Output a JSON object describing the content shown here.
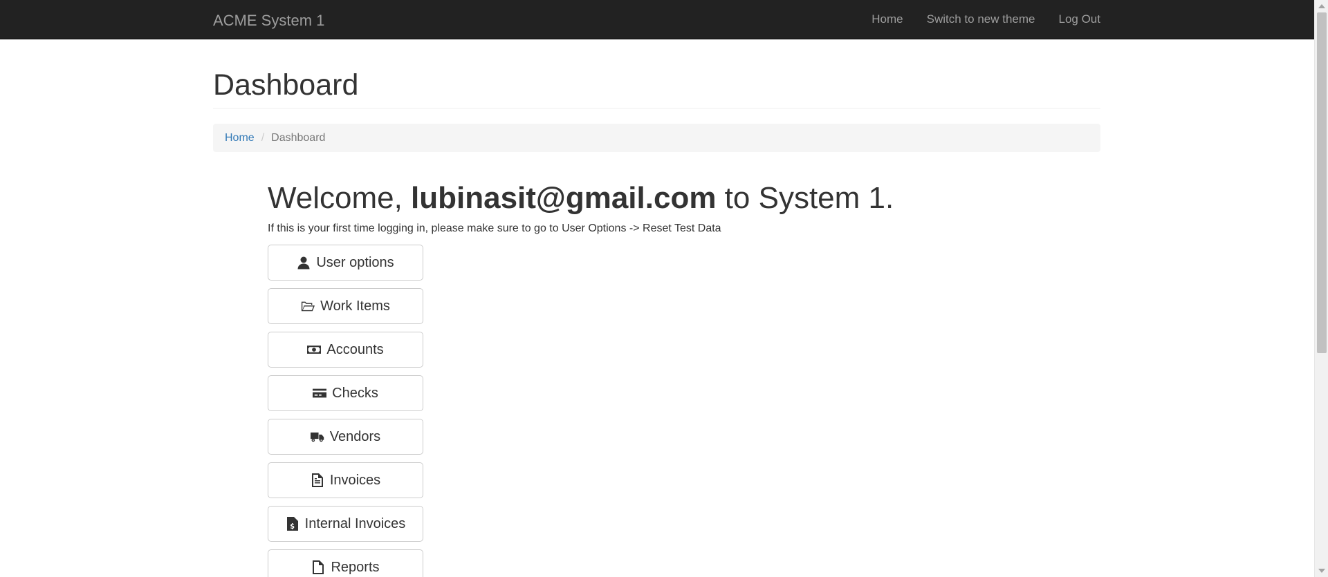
{
  "navbar": {
    "brand": "ACME System 1",
    "links": [
      "Home",
      "Switch to new theme",
      "Log Out"
    ]
  },
  "page": {
    "title": "Dashboard"
  },
  "breadcrumb": {
    "home": "Home",
    "current": "Dashboard"
  },
  "welcome": {
    "prefix": "Welcome, ",
    "user": "lubinasit@gmail.com",
    "suffix": " to System 1.",
    "hint": "If this is your first time logging in, please make sure to go to User Options -> Reset Test Data"
  },
  "menu": [
    {
      "label": "User options",
      "icon": "user-icon"
    },
    {
      "label": "Work Items",
      "icon": "folder-open-icon"
    },
    {
      "label": "Accounts",
      "icon": "money-bill-icon"
    },
    {
      "label": "Checks",
      "icon": "credit-card-icon"
    },
    {
      "label": "Vendors",
      "icon": "truck-icon"
    },
    {
      "label": "Invoices",
      "icon": "file-text-icon"
    },
    {
      "label": "Internal Invoices",
      "icon": "file-invoice-dollar-icon"
    },
    {
      "label": "Reports",
      "icon": "file-icon"
    }
  ],
  "colors": {
    "navbar_bg": "#222222",
    "navbar_text": "#9d9d9d",
    "link": "#337ab7",
    "breadcrumb_bg": "#f5f5f5"
  }
}
